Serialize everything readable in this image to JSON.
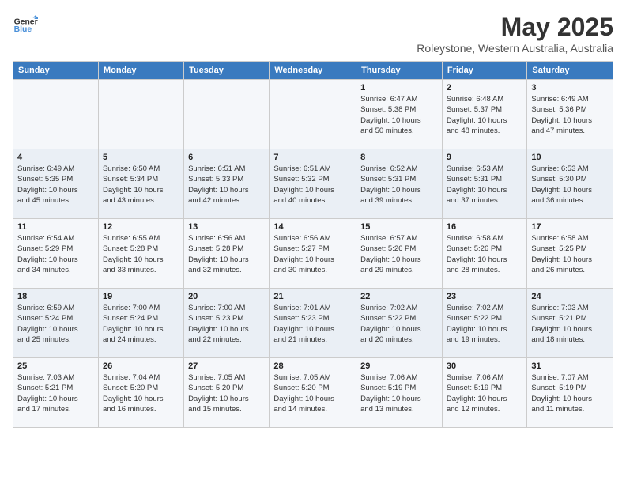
{
  "header": {
    "logo_line1": "General",
    "logo_line2": "Blue",
    "title": "May 2025",
    "subtitle": "Roleystone, Western Australia, Australia"
  },
  "days_of_week": [
    "Sunday",
    "Monday",
    "Tuesday",
    "Wednesday",
    "Thursday",
    "Friday",
    "Saturday"
  ],
  "weeks": [
    [
      {
        "num": "",
        "info": ""
      },
      {
        "num": "",
        "info": ""
      },
      {
        "num": "",
        "info": ""
      },
      {
        "num": "",
        "info": ""
      },
      {
        "num": "1",
        "info": "Sunrise: 6:47 AM\nSunset: 5:38 PM\nDaylight: 10 hours\nand 50 minutes."
      },
      {
        "num": "2",
        "info": "Sunrise: 6:48 AM\nSunset: 5:37 PM\nDaylight: 10 hours\nand 48 minutes."
      },
      {
        "num": "3",
        "info": "Sunrise: 6:49 AM\nSunset: 5:36 PM\nDaylight: 10 hours\nand 47 minutes."
      }
    ],
    [
      {
        "num": "4",
        "info": "Sunrise: 6:49 AM\nSunset: 5:35 PM\nDaylight: 10 hours\nand 45 minutes."
      },
      {
        "num": "5",
        "info": "Sunrise: 6:50 AM\nSunset: 5:34 PM\nDaylight: 10 hours\nand 43 minutes."
      },
      {
        "num": "6",
        "info": "Sunrise: 6:51 AM\nSunset: 5:33 PM\nDaylight: 10 hours\nand 42 minutes."
      },
      {
        "num": "7",
        "info": "Sunrise: 6:51 AM\nSunset: 5:32 PM\nDaylight: 10 hours\nand 40 minutes."
      },
      {
        "num": "8",
        "info": "Sunrise: 6:52 AM\nSunset: 5:31 PM\nDaylight: 10 hours\nand 39 minutes."
      },
      {
        "num": "9",
        "info": "Sunrise: 6:53 AM\nSunset: 5:31 PM\nDaylight: 10 hours\nand 37 minutes."
      },
      {
        "num": "10",
        "info": "Sunrise: 6:53 AM\nSunset: 5:30 PM\nDaylight: 10 hours\nand 36 minutes."
      }
    ],
    [
      {
        "num": "11",
        "info": "Sunrise: 6:54 AM\nSunset: 5:29 PM\nDaylight: 10 hours\nand 34 minutes."
      },
      {
        "num": "12",
        "info": "Sunrise: 6:55 AM\nSunset: 5:28 PM\nDaylight: 10 hours\nand 33 minutes."
      },
      {
        "num": "13",
        "info": "Sunrise: 6:56 AM\nSunset: 5:28 PM\nDaylight: 10 hours\nand 32 minutes."
      },
      {
        "num": "14",
        "info": "Sunrise: 6:56 AM\nSunset: 5:27 PM\nDaylight: 10 hours\nand 30 minutes."
      },
      {
        "num": "15",
        "info": "Sunrise: 6:57 AM\nSunset: 5:26 PM\nDaylight: 10 hours\nand 29 minutes."
      },
      {
        "num": "16",
        "info": "Sunrise: 6:58 AM\nSunset: 5:26 PM\nDaylight: 10 hours\nand 28 minutes."
      },
      {
        "num": "17",
        "info": "Sunrise: 6:58 AM\nSunset: 5:25 PM\nDaylight: 10 hours\nand 26 minutes."
      }
    ],
    [
      {
        "num": "18",
        "info": "Sunrise: 6:59 AM\nSunset: 5:24 PM\nDaylight: 10 hours\nand 25 minutes."
      },
      {
        "num": "19",
        "info": "Sunrise: 7:00 AM\nSunset: 5:24 PM\nDaylight: 10 hours\nand 24 minutes."
      },
      {
        "num": "20",
        "info": "Sunrise: 7:00 AM\nSunset: 5:23 PM\nDaylight: 10 hours\nand 22 minutes."
      },
      {
        "num": "21",
        "info": "Sunrise: 7:01 AM\nSunset: 5:23 PM\nDaylight: 10 hours\nand 21 minutes."
      },
      {
        "num": "22",
        "info": "Sunrise: 7:02 AM\nSunset: 5:22 PM\nDaylight: 10 hours\nand 20 minutes."
      },
      {
        "num": "23",
        "info": "Sunrise: 7:02 AM\nSunset: 5:22 PM\nDaylight: 10 hours\nand 19 minutes."
      },
      {
        "num": "24",
        "info": "Sunrise: 7:03 AM\nSunset: 5:21 PM\nDaylight: 10 hours\nand 18 minutes."
      }
    ],
    [
      {
        "num": "25",
        "info": "Sunrise: 7:03 AM\nSunset: 5:21 PM\nDaylight: 10 hours\nand 17 minutes."
      },
      {
        "num": "26",
        "info": "Sunrise: 7:04 AM\nSunset: 5:20 PM\nDaylight: 10 hours\nand 16 minutes."
      },
      {
        "num": "27",
        "info": "Sunrise: 7:05 AM\nSunset: 5:20 PM\nDaylight: 10 hours\nand 15 minutes."
      },
      {
        "num": "28",
        "info": "Sunrise: 7:05 AM\nSunset: 5:20 PM\nDaylight: 10 hours\nand 14 minutes."
      },
      {
        "num": "29",
        "info": "Sunrise: 7:06 AM\nSunset: 5:19 PM\nDaylight: 10 hours\nand 13 minutes."
      },
      {
        "num": "30",
        "info": "Sunrise: 7:06 AM\nSunset: 5:19 PM\nDaylight: 10 hours\nand 12 minutes."
      },
      {
        "num": "31",
        "info": "Sunrise: 7:07 AM\nSunset: 5:19 PM\nDaylight: 10 hours\nand 11 minutes."
      }
    ]
  ]
}
